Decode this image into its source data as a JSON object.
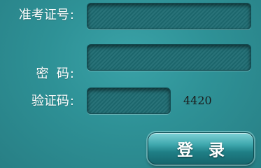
{
  "form": {
    "ticket_label": "准考证号",
    "password_label": "密  码",
    "captcha_label": "验证码",
    "colon": ":",
    "ticket_value": "",
    "password_value": "",
    "captcha_value": "",
    "captcha_code": "4420",
    "login_label": "登录"
  },
  "colors": {
    "background": "#2e8f95",
    "field": "#1e6c72",
    "button": "#2a8f96",
    "label_text": "#ffffff",
    "captcha_text": "#1a1a1a"
  }
}
